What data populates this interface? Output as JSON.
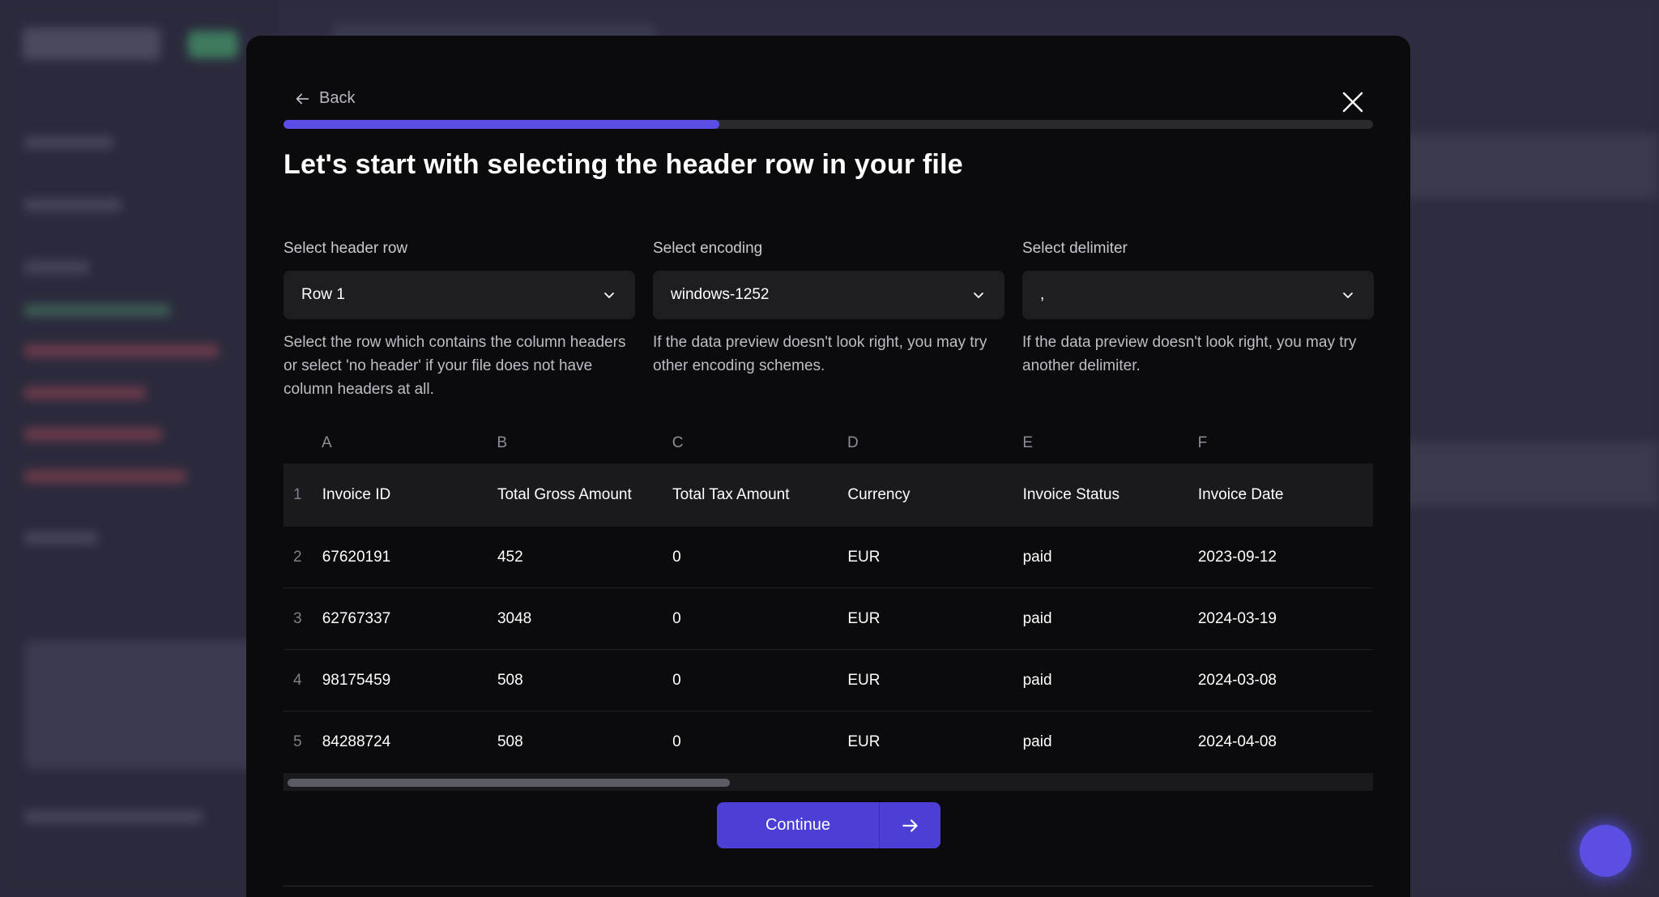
{
  "modal": {
    "back_label": "Back",
    "progress_fraction": 0.4,
    "title": "Let's start with selecting the header row in your file",
    "fields": [
      {
        "label": "Select header row",
        "value": "Row 1",
        "help": "Select the row which contains the column headers or select 'no header' if your file does not have column headers at all."
      },
      {
        "label": "Select encoding",
        "value": "windows-1252",
        "help": "If the data preview doesn't look right, you may try other encoding schemes."
      },
      {
        "label": "Select delimiter",
        "value": ",",
        "help": "If the data preview doesn't look right, you may try another delimiter."
      }
    ],
    "table": {
      "column_letters": [
        "A",
        "B",
        "C",
        "D",
        "E",
        "F"
      ],
      "rows": [
        {
          "n": "1",
          "cells": [
            "Invoice ID",
            "Total Gross Amount",
            "Total Tax Amount",
            "Currency",
            "Invoice Status",
            "Invoice Date"
          ]
        },
        {
          "n": "2",
          "cells": [
            "67620191",
            "452",
            "0",
            "EUR",
            "paid",
            "2023-09-12"
          ]
        },
        {
          "n": "3",
          "cells": [
            "62767337",
            "3048",
            "0",
            "EUR",
            "paid",
            "2024-03-19"
          ]
        },
        {
          "n": "4",
          "cells": [
            "98175459",
            "508",
            "0",
            "EUR",
            "paid",
            "2024-03-08"
          ]
        },
        {
          "n": "5",
          "cells": [
            "84288724",
            "508",
            "0",
            "EUR",
            "paid",
            "2024-04-08"
          ]
        }
      ]
    },
    "continue_label": "Continue"
  },
  "icons": {
    "back": "arrow-left-icon",
    "close": "close-icon",
    "dropdown": "chevron-down-icon",
    "continue": "arrow-right-icon"
  },
  "colors": {
    "accent": "#5a4ee6",
    "button": "#4b3fd6",
    "modal_bg": "#0b0b0d"
  }
}
